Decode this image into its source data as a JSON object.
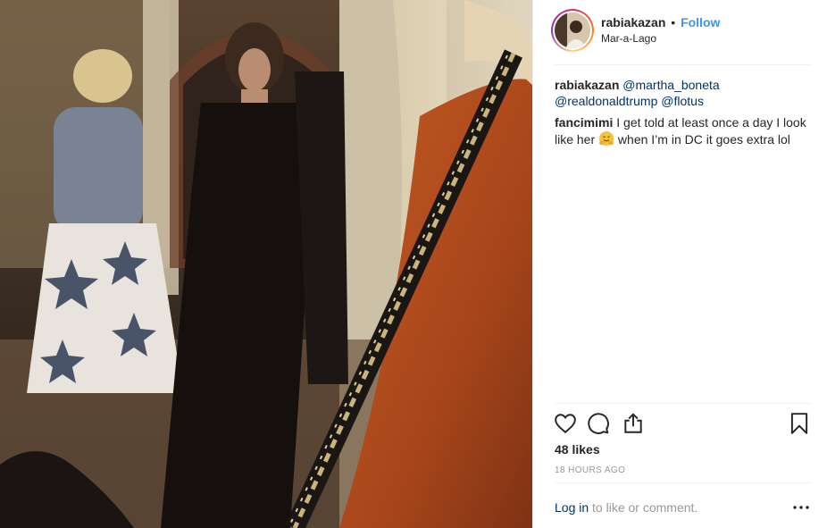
{
  "post": {
    "username": "rabiakazan",
    "separator": "•",
    "follow_label": "Follow",
    "location": "Mar-a-Lago"
  },
  "comments": [
    {
      "user": "rabiakazan",
      "mentions": [
        "@martha_boneta",
        "@realdonaldtrump",
        "@flotus"
      ]
    },
    {
      "user": "fancimimi",
      "text_before": "I get told at least once a day I look like her",
      "emoji": "hugging-face-emoji",
      "text_after": "when I’m in DC it goes extra lol"
    }
  ],
  "actions": {
    "like_icon": "heart-icon",
    "comment_icon": "comment-icon",
    "share_icon": "share-icon",
    "save_icon": "bookmark-icon"
  },
  "likes": "48 likes",
  "timestamp": "18 HOURS AGO",
  "footer": {
    "login_link": "Log in",
    "login_suffix": "to like or comment.",
    "more_icon": "more-options-icon"
  },
  "colors": {
    "link_blue": "#3897f0",
    "mention_blue": "#003569",
    "muted_gray": "#999999",
    "text": "#262626"
  }
}
